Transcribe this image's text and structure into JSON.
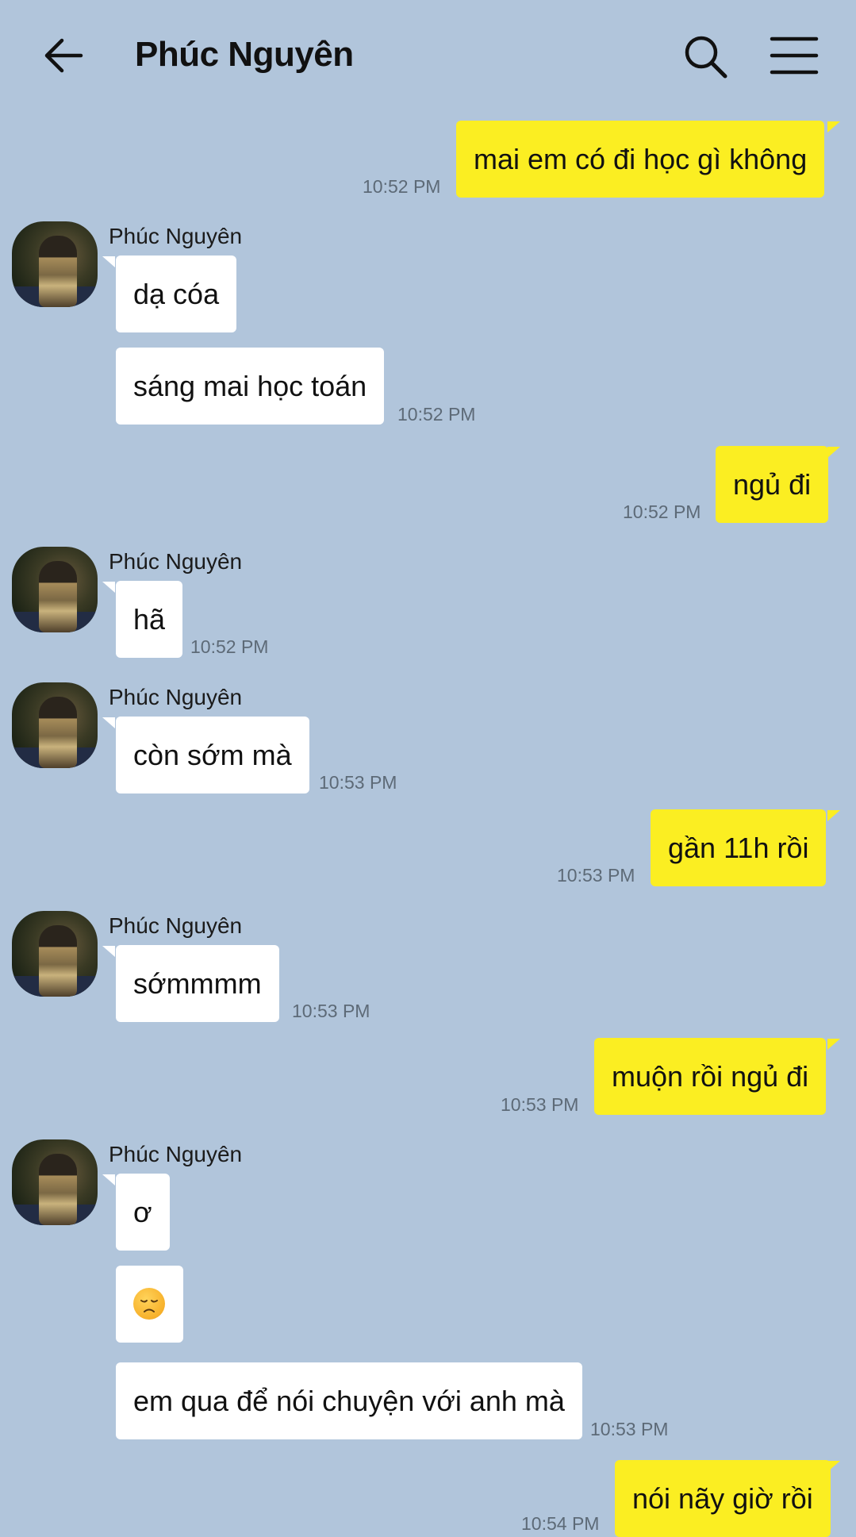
{
  "header": {
    "title": "Phúc Nguyên",
    "back_icon": "arrow-left-icon",
    "search_icon": "search-icon",
    "menu_icon": "hamburger-menu-icon"
  },
  "colors": {
    "background": "#b1c5db",
    "incoming_bubble": "#ffffff",
    "outgoing_bubble": "#fbee22",
    "timestamp": "#5d6a77"
  },
  "messages": [
    {
      "direction": "out",
      "text": "mai em có đi học gì không",
      "time": "10:52 PM"
    },
    {
      "direction": "in",
      "sender": "Phúc Nguyên",
      "text": "dạ cóa"
    },
    {
      "direction": "in",
      "text": "sáng mai học toán",
      "time": "10:52 PM"
    },
    {
      "direction": "out",
      "text": "ngủ đi",
      "time": "10:52 PM"
    },
    {
      "direction": "in",
      "sender": "Phúc Nguyên",
      "text": "hã",
      "time": "10:52 PM"
    },
    {
      "direction": "in",
      "sender": "Phúc Nguyên",
      "text": "còn sớm mà",
      "time": "10:53 PM"
    },
    {
      "direction": "out",
      "text": "gần 11h rồi",
      "time": "10:53 PM"
    },
    {
      "direction": "in",
      "sender": "Phúc Nguyên",
      "text": "sớmmmm",
      "time": "10:53 PM"
    },
    {
      "direction": "out",
      "text": "muộn rồi ngủ đi",
      "time": "10:53 PM"
    },
    {
      "direction": "in",
      "sender": "Phúc Nguyên",
      "text": "ơ"
    },
    {
      "direction": "in",
      "emoji": "disappointed-face-emoji"
    },
    {
      "direction": "in",
      "text": "em qua để nói chuyện với anh mà",
      "time": "10:53 PM"
    },
    {
      "direction": "out",
      "text": "nói nãy giờ rồi",
      "time": "10:54 PM"
    }
  ]
}
